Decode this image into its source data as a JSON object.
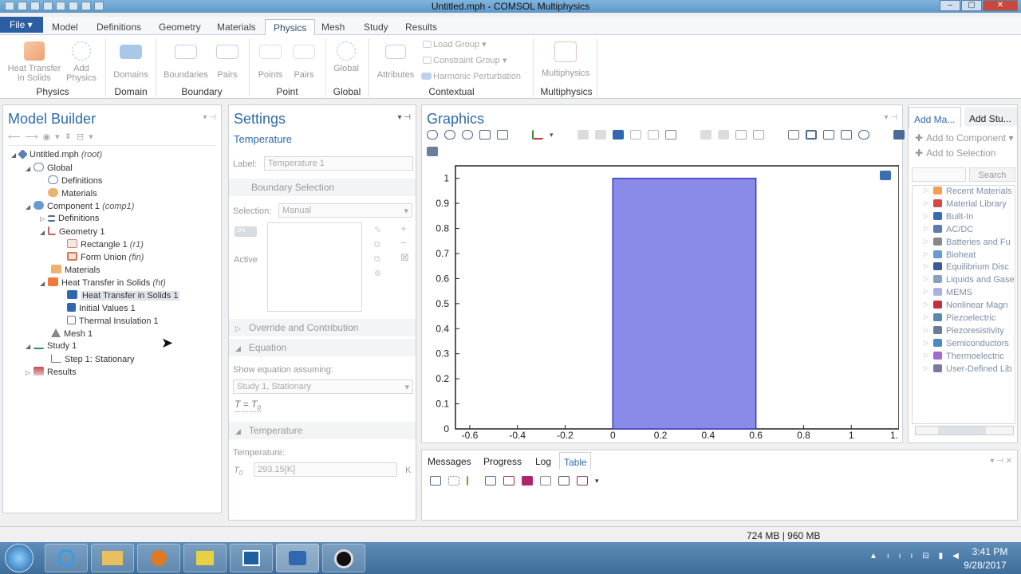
{
  "window": {
    "title": "Untitled.mph - COMSOL Multiphysics"
  },
  "menu_tabs": {
    "file": "File ▾",
    "model": "Model",
    "definitions": "Definitions",
    "geometry": "Geometry",
    "materials": "Materials",
    "physics": "Physics",
    "mesh": "Mesh",
    "study": "Study",
    "results": "Results"
  },
  "ribbon": {
    "heat_transfer_line1": "Heat Transfer",
    "heat_transfer_line2": "in Solids",
    "add_physics_line1": "Add",
    "add_physics_line2": "Physics",
    "domains": "Domains",
    "boundaries": "Boundaries",
    "pairs1": "Pairs",
    "points": "Points",
    "pairs2": "Pairs",
    "global": "Global",
    "attributes": "Attributes",
    "load_group": "Load Group ▾",
    "constraint_group": "Constraint Group ▾",
    "harmonic_perturbation": "Harmonic Perturbation",
    "multiphysics": "Multiphysics",
    "groups": {
      "physics": "Physics",
      "domain": "Domain",
      "boundary": "Boundary",
      "point": "Point",
      "global": "Global",
      "contextual": "Contextual",
      "multiphysics": "Multiphysics"
    }
  },
  "model_builder": {
    "title": "Model Builder",
    "tree": {
      "root": "Untitled.mph",
      "root_tag": "(root)",
      "global": "Global",
      "definitions": "Definitions",
      "materials": "Materials",
      "component": "Component 1",
      "component_tag": "(comp1)",
      "comp_definitions": "Definitions",
      "geometry": "Geometry 1",
      "rectangle": "Rectangle 1",
      "rectangle_tag": "(r1)",
      "form_union": "Form Union",
      "form_union_tag": "(fin)",
      "comp_materials": "Materials",
      "heat_transfer": "Heat Transfer in Solids",
      "heat_transfer_tag": "(ht)",
      "hts1": "Heat Transfer in Solids 1",
      "initial_values": "Initial Values 1",
      "thermal_insulation": "Thermal Insulation 1",
      "mesh": "Mesh 1",
      "study": "Study 1",
      "step": "Step 1: Stationary",
      "results": "Results"
    }
  },
  "settings": {
    "title": "Settings",
    "subtitle": "Temperature",
    "label_label": "Label:",
    "label_value": "Temperature 1",
    "boundary_selection": "Boundary Selection",
    "selection_label": "Selection:",
    "selection_value": "Manual",
    "toggle": "ON",
    "active": "Active",
    "override": "Override and Contribution",
    "equation": "Equation",
    "show_equation": "Show equation assuming:",
    "study_value": "Study 1, Stationary",
    "equation_text": "T = T",
    "temperature_section": "Temperature",
    "temperature_label": "Temperature:",
    "t0_symbol": "T",
    "t0_value": "293.15[K]",
    "unit": "K"
  },
  "graphics": {
    "title": "Graphics"
  },
  "chart_data": {
    "type": "area",
    "x_ticks": [
      "-0.6",
      "-0.4",
      "-0.2",
      "0",
      "0.2",
      "0.4",
      "0.6",
      "0.8",
      "1",
      "1."
    ],
    "y_ticks": [
      "0",
      "0.1",
      "0.2",
      "0.3",
      "0.4",
      "0.5",
      "0.6",
      "0.7",
      "0.8",
      "0.9",
      "1"
    ],
    "xlim": [
      -0.66,
      1.2
    ],
    "ylim": [
      0,
      1.05
    ],
    "shapes": [
      {
        "name": "Rectangle 1",
        "x": [
          0,
          0.6
        ],
        "y": [
          0,
          1
        ],
        "fill": "#8a8be8",
        "stroke": "#3a3cc0"
      }
    ]
  },
  "add_material": {
    "tab1": "Add Ma...",
    "tab2": "Add Stu...",
    "add_component": "Add to Component",
    "add_selection": "Add to Selection",
    "search": "Search",
    "items": [
      "Recent Materials",
      "Material Library",
      "Built-In",
      "AC/DC",
      "Batteries and Fu",
      "Bioheat",
      "Equilibrium Disc",
      "Liquids and Gase",
      "MEMS",
      "Nonlinear Magn",
      "Piezoelectric",
      "Piezoresistivity",
      "Semiconductors",
      "Thermoelectric",
      "User-Defined Lib"
    ]
  },
  "bottom": {
    "messages": "Messages",
    "progress": "Progress",
    "log": "Log",
    "table": "Table"
  },
  "status": {
    "memory": "724 MB | 960 MB"
  },
  "taskbar": {
    "time": "3:41 PM",
    "date": "9/28/2017"
  },
  "colors": {
    "accent": "#2f6aa8",
    "geometry_fill": "#8a8be8",
    "geometry_stroke": "#3a3cc0",
    "taskbar": "#4a7aa8"
  }
}
